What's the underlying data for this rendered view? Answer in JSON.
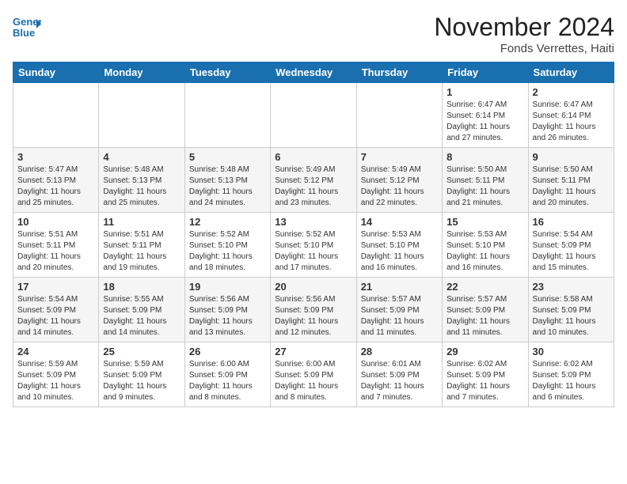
{
  "header": {
    "logo_line1": "General",
    "logo_line2": "Blue",
    "month": "November 2024",
    "location": "Fonds Verrettes, Haiti"
  },
  "weekdays": [
    "Sunday",
    "Monday",
    "Tuesday",
    "Wednesday",
    "Thursday",
    "Friday",
    "Saturday"
  ],
  "weeks": [
    [
      {
        "day": null,
        "info": null
      },
      {
        "day": null,
        "info": null
      },
      {
        "day": null,
        "info": null
      },
      {
        "day": null,
        "info": null
      },
      {
        "day": null,
        "info": null
      },
      {
        "day": "1",
        "info": "Sunrise: 6:47 AM\nSunset: 6:14 PM\nDaylight: 11 hours\nand 27 minutes."
      },
      {
        "day": "2",
        "info": "Sunrise: 6:47 AM\nSunset: 6:14 PM\nDaylight: 11 hours\nand 26 minutes."
      }
    ],
    [
      {
        "day": "3",
        "info": "Sunrise: 5:47 AM\nSunset: 5:13 PM\nDaylight: 11 hours\nand 25 minutes."
      },
      {
        "day": "4",
        "info": "Sunrise: 5:48 AM\nSunset: 5:13 PM\nDaylight: 11 hours\nand 25 minutes."
      },
      {
        "day": "5",
        "info": "Sunrise: 5:48 AM\nSunset: 5:13 PM\nDaylight: 11 hours\nand 24 minutes."
      },
      {
        "day": "6",
        "info": "Sunrise: 5:49 AM\nSunset: 5:12 PM\nDaylight: 11 hours\nand 23 minutes."
      },
      {
        "day": "7",
        "info": "Sunrise: 5:49 AM\nSunset: 5:12 PM\nDaylight: 11 hours\nand 22 minutes."
      },
      {
        "day": "8",
        "info": "Sunrise: 5:50 AM\nSunset: 5:11 PM\nDaylight: 11 hours\nand 21 minutes."
      },
      {
        "day": "9",
        "info": "Sunrise: 5:50 AM\nSunset: 5:11 PM\nDaylight: 11 hours\nand 20 minutes."
      }
    ],
    [
      {
        "day": "10",
        "info": "Sunrise: 5:51 AM\nSunset: 5:11 PM\nDaylight: 11 hours\nand 20 minutes."
      },
      {
        "day": "11",
        "info": "Sunrise: 5:51 AM\nSunset: 5:11 PM\nDaylight: 11 hours\nand 19 minutes."
      },
      {
        "day": "12",
        "info": "Sunrise: 5:52 AM\nSunset: 5:10 PM\nDaylight: 11 hours\nand 18 minutes."
      },
      {
        "day": "13",
        "info": "Sunrise: 5:52 AM\nSunset: 5:10 PM\nDaylight: 11 hours\nand 17 minutes."
      },
      {
        "day": "14",
        "info": "Sunrise: 5:53 AM\nSunset: 5:10 PM\nDaylight: 11 hours\nand 16 minutes."
      },
      {
        "day": "15",
        "info": "Sunrise: 5:53 AM\nSunset: 5:10 PM\nDaylight: 11 hours\nand 16 minutes."
      },
      {
        "day": "16",
        "info": "Sunrise: 5:54 AM\nSunset: 5:09 PM\nDaylight: 11 hours\nand 15 minutes."
      }
    ],
    [
      {
        "day": "17",
        "info": "Sunrise: 5:54 AM\nSunset: 5:09 PM\nDaylight: 11 hours\nand 14 minutes."
      },
      {
        "day": "18",
        "info": "Sunrise: 5:55 AM\nSunset: 5:09 PM\nDaylight: 11 hours\nand 14 minutes."
      },
      {
        "day": "19",
        "info": "Sunrise: 5:56 AM\nSunset: 5:09 PM\nDaylight: 11 hours\nand 13 minutes."
      },
      {
        "day": "20",
        "info": "Sunrise: 5:56 AM\nSunset: 5:09 PM\nDaylight: 11 hours\nand 12 minutes."
      },
      {
        "day": "21",
        "info": "Sunrise: 5:57 AM\nSunset: 5:09 PM\nDaylight: 11 hours\nand 11 minutes."
      },
      {
        "day": "22",
        "info": "Sunrise: 5:57 AM\nSunset: 5:09 PM\nDaylight: 11 hours\nand 11 minutes."
      },
      {
        "day": "23",
        "info": "Sunrise: 5:58 AM\nSunset: 5:09 PM\nDaylight: 11 hours\nand 10 minutes."
      }
    ],
    [
      {
        "day": "24",
        "info": "Sunrise: 5:59 AM\nSunset: 5:09 PM\nDaylight: 11 hours\nand 10 minutes."
      },
      {
        "day": "25",
        "info": "Sunrise: 5:59 AM\nSunset: 5:09 PM\nDaylight: 11 hours\nand 9 minutes."
      },
      {
        "day": "26",
        "info": "Sunrise: 6:00 AM\nSunset: 5:09 PM\nDaylight: 11 hours\nand 8 minutes."
      },
      {
        "day": "27",
        "info": "Sunrise: 6:00 AM\nSunset: 5:09 PM\nDaylight: 11 hours\nand 8 minutes."
      },
      {
        "day": "28",
        "info": "Sunrise: 6:01 AM\nSunset: 5:09 PM\nDaylight: 11 hours\nand 7 minutes."
      },
      {
        "day": "29",
        "info": "Sunrise: 6:02 AM\nSunset: 5:09 PM\nDaylight: 11 hours\nand 7 minutes."
      },
      {
        "day": "30",
        "info": "Sunrise: 6:02 AM\nSunset: 5:09 PM\nDaylight: 11 hours\nand 6 minutes."
      }
    ]
  ]
}
